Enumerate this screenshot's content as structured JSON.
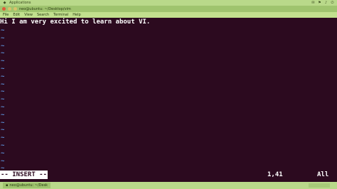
{
  "top_panel": {
    "left_label": "Applications",
    "right_glyphs": [
      "✉",
      "⚑",
      "♪",
      "⏻"
    ]
  },
  "window": {
    "title": "neo@ubuntu: ~/Desktop/vim",
    "menu_items": [
      "File",
      "Edit",
      "View",
      "Search",
      "Terminal",
      "Help"
    ]
  },
  "terminal": {
    "lines": [
      "Hi I am very excited to learn about VI."
    ],
    "tilde_count": 20,
    "tilde_char": "~"
  },
  "status": {
    "mode": "-- INSERT --",
    "position": "1,41",
    "scroll": "All"
  },
  "taskbar": {
    "item": "neo@ubuntu: ~/Desk"
  },
  "colors": {
    "terminal_bg": "#2c0a1f",
    "panel_green": "#b9d98a",
    "tilde_blue": "#5b8fd6"
  }
}
